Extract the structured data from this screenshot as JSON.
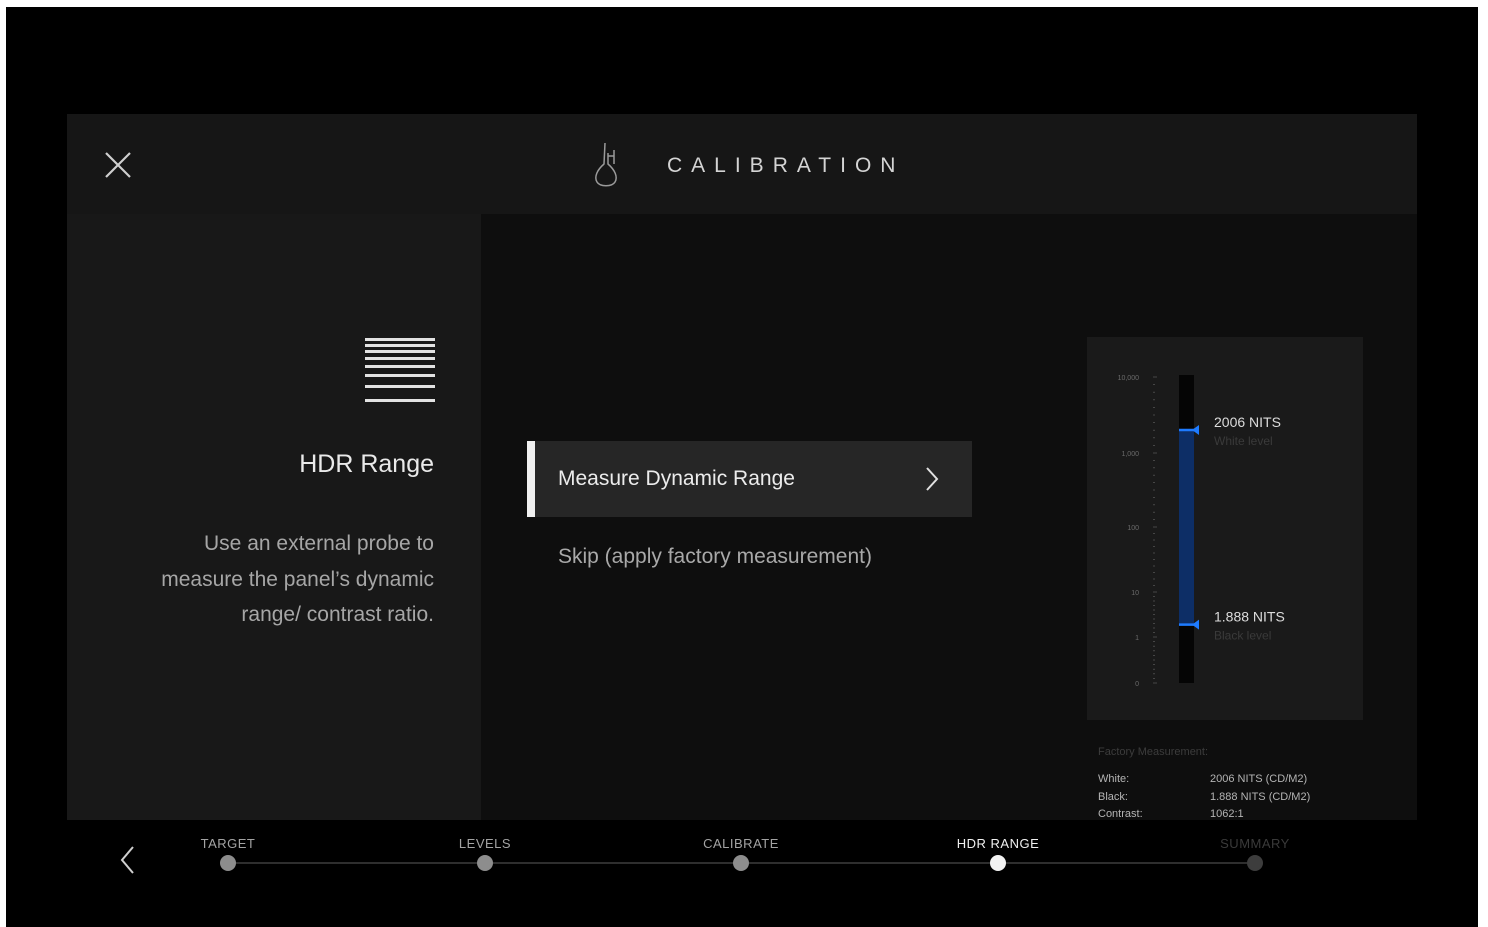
{
  "header": {
    "title": "CALIBRATION"
  },
  "left_panel": {
    "title": "HDR Range",
    "description": "Use an external probe to measure the panel’s dynamic range/ contrast ratio."
  },
  "actions": {
    "measure_label": "Measure Dynamic Range",
    "skip_label": "Skip (apply factory measurement)"
  },
  "gauge": {
    "ticks": [
      "10,000",
      "1,000",
      "100",
      "10",
      "1",
      "0"
    ],
    "white": {
      "value": "2006 NITS",
      "label": "White level",
      "nits": 2006
    },
    "black": {
      "value": "1.888 NITS",
      "label": "Black level",
      "nits": 1.888
    }
  },
  "factory": {
    "heading": "Factory Measurement:",
    "rows": [
      {
        "key": "White:",
        "value": "2006 NITS (CD/M2)"
      },
      {
        "key": "Black:",
        "value": "1.888 NITS (CD/M2)"
      },
      {
        "key": "Contrast:",
        "value": "1062:1"
      }
    ]
  },
  "steps": [
    {
      "label": "TARGET",
      "state": "done"
    },
    {
      "label": "LEVELS",
      "state": "done"
    },
    {
      "label": "CALIBRATE",
      "state": "done"
    },
    {
      "label": "HDR RANGE",
      "state": "active"
    },
    {
      "label": "SUMMARY",
      "state": "pending"
    }
  ],
  "colors": {
    "accent": "#1e7bff",
    "gauge_fill": "#0d2e66"
  }
}
